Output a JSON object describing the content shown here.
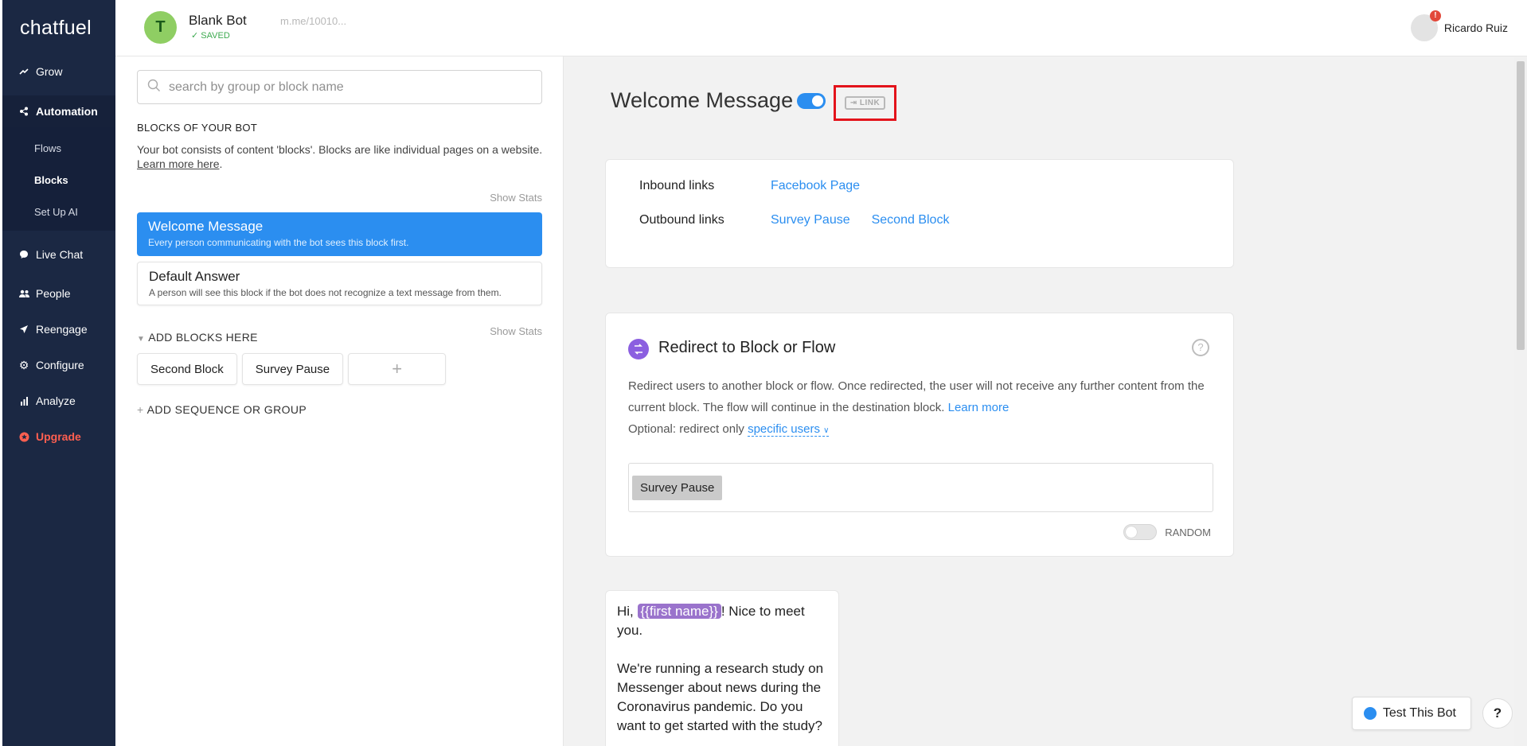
{
  "sidebar": {
    "logo": "chatfuel",
    "items": [
      {
        "label": "Grow",
        "icon": "trending-up-icon"
      },
      {
        "label": "Automation",
        "icon": "flow-icon"
      },
      {
        "label": "Live Chat",
        "icon": "chat-bubble-icon"
      },
      {
        "label": "People",
        "icon": "people-icon"
      },
      {
        "label": "Reengage",
        "icon": "paper-plane-icon"
      },
      {
        "label": "Configure",
        "icon": "gear-icon"
      },
      {
        "label": "Analyze",
        "icon": "bar-chart-icon"
      },
      {
        "label": "Upgrade",
        "icon": "upgrade-icon"
      }
    ],
    "subitems": [
      {
        "label": "Flows"
      },
      {
        "label": "Blocks"
      },
      {
        "label": "Set Up AI"
      }
    ]
  },
  "topbar": {
    "bot_initial": "T",
    "bot_name": "Blank Bot",
    "saved": "SAVED",
    "bot_url": "m.me/10010...",
    "user_name": "Ricardo Ruiz",
    "notification": "!"
  },
  "blocks": {
    "search_placeholder": "search by group or block name",
    "section_title": "BLOCKS OF YOUR BOT",
    "description": "Your bot consists of content 'blocks'. Blocks are like individual pages on a website.",
    "learn_more": "Learn more here",
    "show_stats": "Show Stats",
    "cards": [
      {
        "title": "Welcome Message",
        "desc": "Every person communicating with the bot sees this block first."
      },
      {
        "title": "Default Answer",
        "desc": "A person will see this block if the bot does not recognize a text message from them."
      }
    ],
    "add_title": "ADD BLOCKS HERE",
    "chips": [
      "Second Block",
      "Survey Pause"
    ],
    "plus": "+",
    "add_sequence": "ADD SEQUENCE OR GROUP"
  },
  "content": {
    "title": "Welcome Message",
    "link_label": "LINK",
    "inbound_label": "Inbound links",
    "inbound": [
      "Facebook Page"
    ],
    "outbound_label": "Outbound links",
    "outbound": [
      "Survey Pause",
      "Second Block"
    ],
    "redirect": {
      "title": "Redirect to Block or Flow",
      "help": "?",
      "desc": "Redirect users to another block or flow. Once redirected, the user will not receive any further content from the current block. The flow will continue in the destination block.",
      "learn_more": "Learn more",
      "optional": "Optional: redirect only",
      "specific_users": "specific users",
      "target": "Survey Pause",
      "random": "RANDOM"
    },
    "message": {
      "greeting_pre": "Hi, ",
      "variable": "{{first name}}",
      "greeting_post": "! Nice to meet you.",
      "body": "We're running a research study on Messenger about news during the Coronavirus pandemic. Do you want to get started with the study?"
    },
    "test_bot": "Test This Bot",
    "help": "?"
  }
}
